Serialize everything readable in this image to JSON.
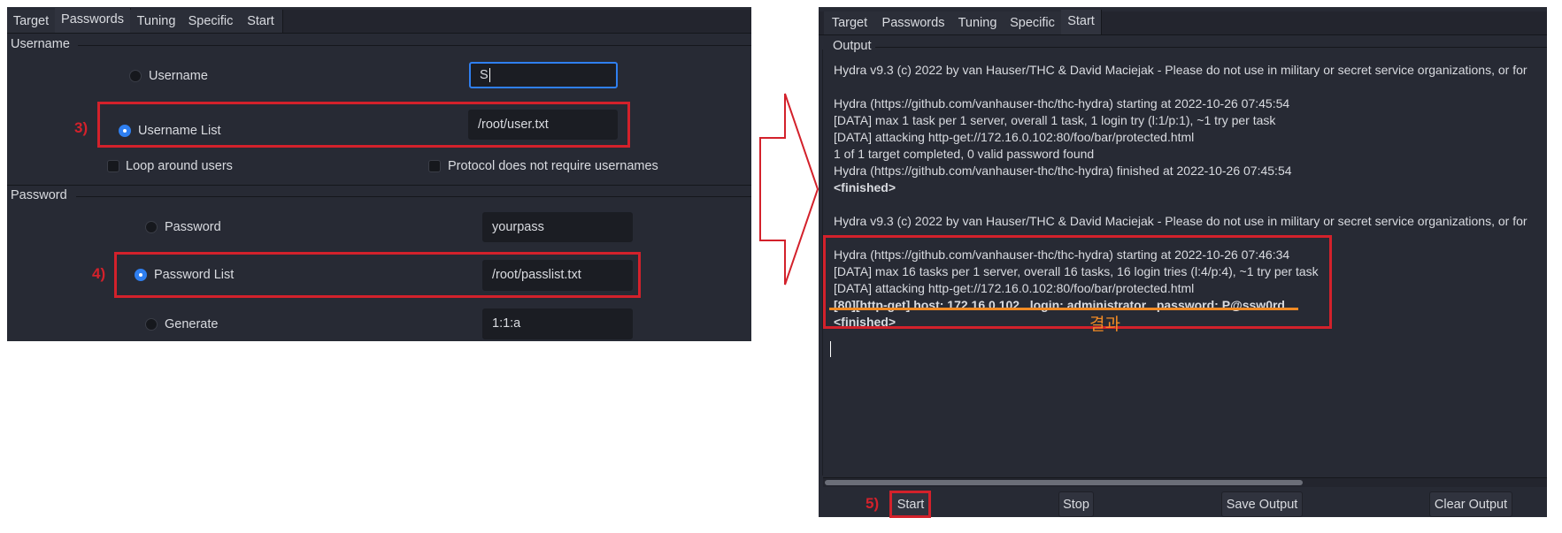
{
  "left_window": {
    "tabs": [
      "Target",
      "Passwords",
      "Tuning",
      "Specific",
      "Start"
    ],
    "active_tab": "Passwords",
    "username_group": {
      "label": "Username",
      "username_radio": "Username",
      "username_value": "S",
      "username_list_radio": "Username List",
      "username_list_value": "/root/user.txt",
      "loop_around_users": "Loop around users",
      "protocol_no_usernames": "Protocol does not require usernames"
    },
    "password_group": {
      "label": "Password",
      "password_radio": "Password",
      "password_value": "yourpass",
      "password_list_radio": "Password List",
      "password_list_value": "/root/passlist.txt",
      "generate_radio": "Generate",
      "generate_value": "1:1:a"
    },
    "selected_username_mode": "Username List",
    "selected_password_mode": "Password List"
  },
  "annotations": {
    "step3": "3)",
    "step4": "4)",
    "step5": "5)",
    "result_label": "결과",
    "highlight_color": "#d3212b",
    "underline_color": "#f08a24"
  },
  "right_window": {
    "tabs": [
      "Target",
      "Passwords",
      "Tuning",
      "Specific",
      "Start"
    ],
    "active_tab": "Start",
    "output_label": "Output",
    "output_lines": [
      "Hydra v9.3 (c) 2022 by van Hauser/THC & David Maciejak - Please do not use in military or secret service organizations, or for",
      "",
      "Hydra (https://github.com/vanhauser-thc/thc-hydra) starting at 2022-10-26 07:45:54",
      "[DATA] max 1 task per 1 server, overall 1 task, 1 login try (l:1/p:1), ~1 try per task",
      "[DATA] attacking http-get://172.16.0.102:80/foo/bar/protected.html",
      "1 of 1 target completed, 0 valid password found",
      "Hydra (https://github.com/vanhauser-thc/thc-hydra) finished at 2022-10-26 07:45:54",
      "<finished>",
      "",
      "Hydra v9.3 (c) 2022 by van Hauser/THC & David Maciejak - Please do not use in military or secret service organizations, or for",
      "",
      "Hydra (https://github.com/vanhauser-thc/thc-hydra) starting at 2022-10-26 07:46:34",
      "[DATA] max 16 tasks per 1 server, overall 16 tasks, 16 login tries (l:4/p:4), ~1 try per task",
      "[DATA] attacking http-get://172.16.0.102:80/foo/bar/protected.html",
      "[80][http-get] host: 172.16.0.102   login: administrator   password: P@ssw0rd",
      "<finished>"
    ],
    "buttons": {
      "start": "Start",
      "stop": "Stop",
      "save_output": "Save Output",
      "clear_output": "Clear Output"
    }
  }
}
